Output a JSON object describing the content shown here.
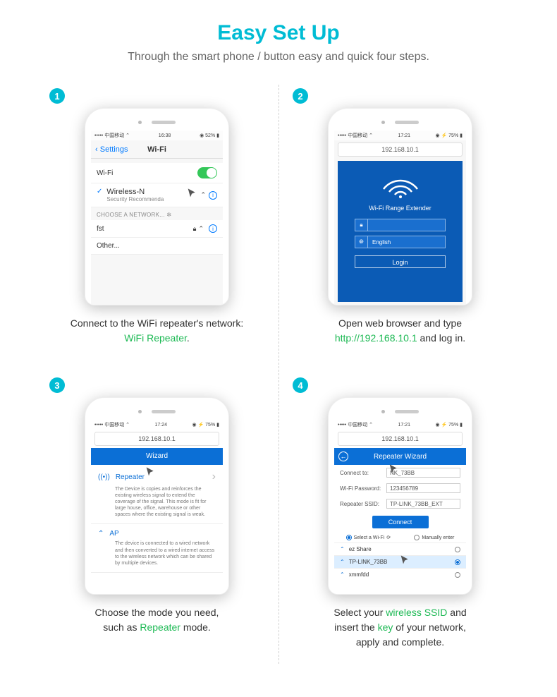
{
  "header": {
    "title": "Easy Set Up",
    "subtitle": "Through the smart phone / button easy and quick four steps."
  },
  "status": {
    "carrier": "••••• 中国移动 ⌃",
    "battery": "◉ ⚡ 75% ▮"
  },
  "step1": {
    "badge": "1",
    "time": "16:38",
    "battery_alt": "◉ 52% ▮",
    "nav_back": "Settings",
    "nav_title": "Wi-Fi",
    "wifi_label": "Wi-Fi",
    "net_name": "Wireless-N",
    "net_sub": "Security Recommenda",
    "choose_label": "CHOOSE A NETWORK...",
    "net2": "fst",
    "other": "Other...",
    "caption_a": "Connect to the WiFi repeater's network:",
    "caption_b": "WiFi Repeater",
    "caption_c": "."
  },
  "step2": {
    "badge": "2",
    "time": "17:21",
    "addr": "192.168.10.1",
    "panel_title": "Wi-Fi Range Extender",
    "lang": "English",
    "login": "Login",
    "caption_a": "Open web browser and type",
    "caption_b": "http://192.168.10.1",
    "caption_c": " and log in."
  },
  "step3": {
    "badge": "3",
    "time": "17:24",
    "addr": "192.168.10.1",
    "wiz": "Wizard",
    "mode1": "Repeater",
    "mode1_desc": "The Device is copies and reinforces the existing wireless signal to extend the coverage of the signal. This mode is fit for large house, office, warehouse or other spaces where the existing signal is weak.",
    "mode2": "AP",
    "mode2_desc": "The device is connected to a wired network and then converted to a wired internet access to the wireless network which can be shared by multiple devices.",
    "caption_a": "Choose the mode you need,",
    "caption_b": "such as ",
    "caption_c": "Repeater",
    "caption_d": " mode."
  },
  "step4": {
    "badge": "4",
    "time": "17:21",
    "addr": "192.168.10.1",
    "rw_title": "Repeater Wizard",
    "f_connect": "Connect to:",
    "v_connect": "       NK_73BB",
    "f_pwd": "Wi-Fi Password:",
    "v_pwd": "123456789",
    "f_ssid": "Repeater SSID:",
    "v_ssid": "TP-LINK_73BB_EXT",
    "connect_btn": "Connect",
    "tab_select": "Select a Wi-Fi",
    "tab_manual": "Manually enter",
    "w1": "ez Share",
    "w2": "TP-LINK_73BB",
    "w3": "xmmfdd",
    "caption_a": "Select your ",
    "caption_b": "wireless SSID",
    "caption_c": " and",
    "caption_d": "insert the ",
    "caption_e": "key",
    "caption_f": " of your network,",
    "caption_g": "apply and complete."
  }
}
